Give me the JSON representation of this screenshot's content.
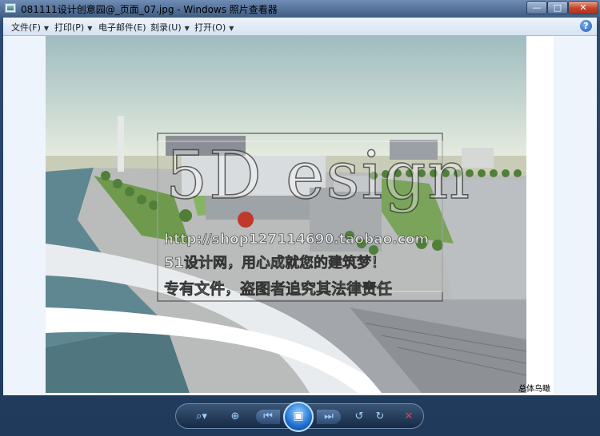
{
  "window": {
    "title": "081111设计创意园@_页面_07.jpg - Windows 照片查看器",
    "controls": {
      "minimize": "—",
      "maximize": "□",
      "close": "✕"
    }
  },
  "menu": {
    "items": [
      {
        "label": "文件(F)"
      },
      {
        "label": "打印(P)"
      },
      {
        "label": "电子邮件(E)"
      },
      {
        "label": "刻录(U)"
      },
      {
        "label": "打开(O)"
      }
    ],
    "help": "?"
  },
  "image": {
    "watermark_lines": [
      "http://shop127114690.taobao.com",
      "51设计网，用心成就您的建筑梦！",
      "专有文件，盗图者追究其法律责任"
    ],
    "watermark_logo": "5D esign",
    "caption": "总体鸟瞰"
  },
  "toolbar": {
    "zoom": "⌕▾",
    "actual_size": "⊕",
    "prev": "⏮",
    "slideshow": "▣",
    "next": "⏭",
    "rotate_ccw": "↺",
    "rotate_cw": "↻",
    "delete": "✕"
  }
}
